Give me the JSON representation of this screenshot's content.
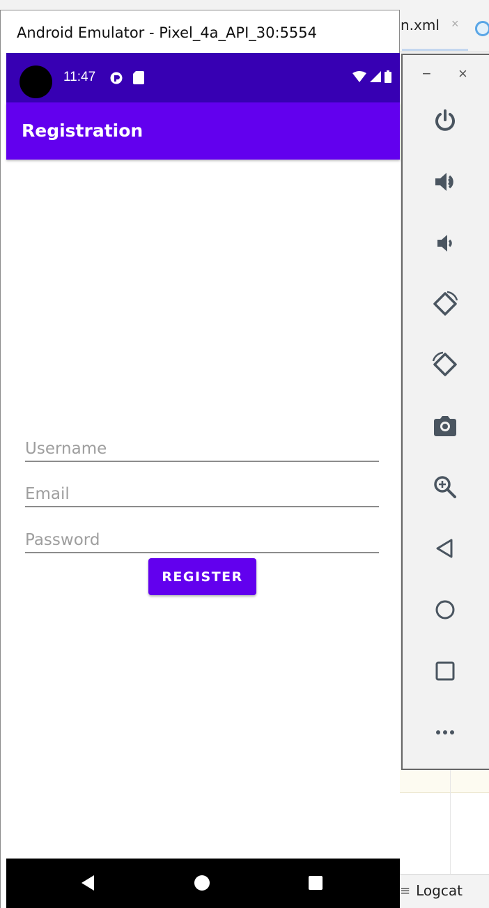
{
  "window": {
    "title": "Android Emulator - Pixel_4a_API_30:5554"
  },
  "ide": {
    "tab_label": "n.xml",
    "tab_close": "×",
    "logcat_label": "Logcat"
  },
  "status_bar": {
    "time": "11:47"
  },
  "app_bar": {
    "title": "Registration"
  },
  "form": {
    "username_placeholder": "Username",
    "email_placeholder": "Email",
    "password_placeholder": "Password",
    "username_value": "",
    "email_value": "",
    "password_value": "",
    "register_label": "REGISTER"
  },
  "toolbar": {
    "minimize": "−",
    "close": "×",
    "buttons": [
      "power-icon",
      "volume-up-icon",
      "volume-down-icon",
      "rotate-left-icon",
      "rotate-right-icon",
      "camera-icon",
      "zoom-icon",
      "back-icon",
      "home-icon",
      "overview-icon",
      "more-icon"
    ]
  },
  "colors": {
    "primary": "#6200ee",
    "primary_dark": "#3700b3",
    "toolbar_icon": "#4a5560"
  }
}
